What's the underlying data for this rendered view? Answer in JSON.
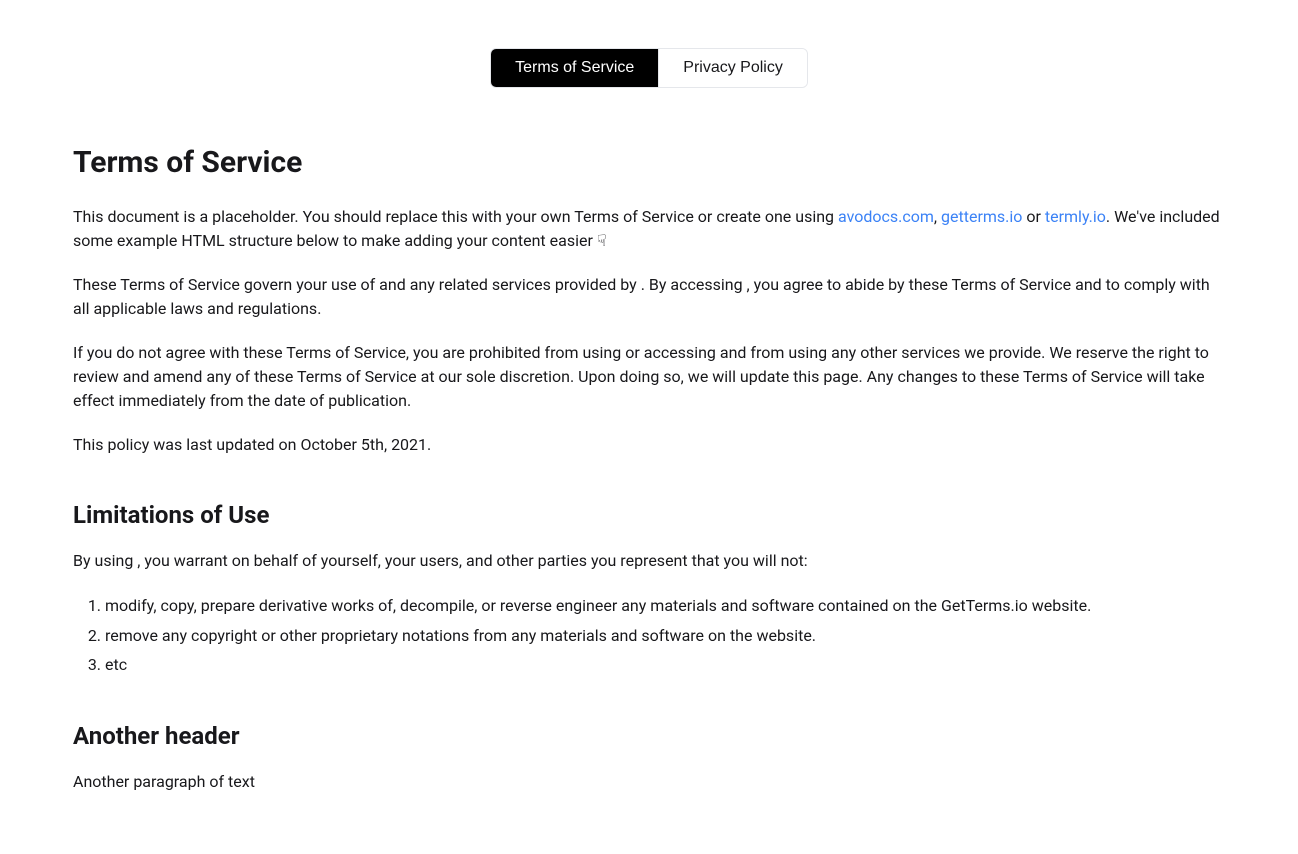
{
  "tabs": {
    "terms": "Terms of Service",
    "privacy": "Privacy Policy"
  },
  "heading": "Terms of Service",
  "intro": {
    "prefix": "This document is a placeholder. You should replace this with your own Terms of Service or create one using ",
    "link1": "avodocs.com",
    "sep1": ", ",
    "link2": "getterms.io",
    "sep2": " or ",
    "link3": "termly.io",
    "suffix": ". We've included some example HTML structure below to make adding your content easier ☟"
  },
  "para2": "These Terms of Service govern your use of and any related services provided by . By accessing , you agree to abide by these Terms of Service and to comply with all applicable laws and regulations.",
  "para3": "If you do not agree with these Terms of Service, you are prohibited from using or accessing and from using any other services we provide. We reserve the right to review and amend any of these Terms of Service at our sole discretion. Upon doing so, we will update this page. Any changes to these Terms of Service will take effect immediately from the date of publication.",
  "para4": "This policy was last updated on October 5th, 2021.",
  "section2": {
    "heading": "Limitations of Use",
    "intro": "By using , you warrant on behalf of yourself, your users, and other parties you represent that you will not:",
    "items": {
      "0": "modify, copy, prepare derivative works of, decompile, or reverse engineer any materials and software contained on the GetTerms.io website.",
      "1": "remove any copyright or other proprietary notations from any materials and software on the website.",
      "2": "etc"
    }
  },
  "section3": {
    "heading": "Another header",
    "para": "Another paragraph of text"
  }
}
